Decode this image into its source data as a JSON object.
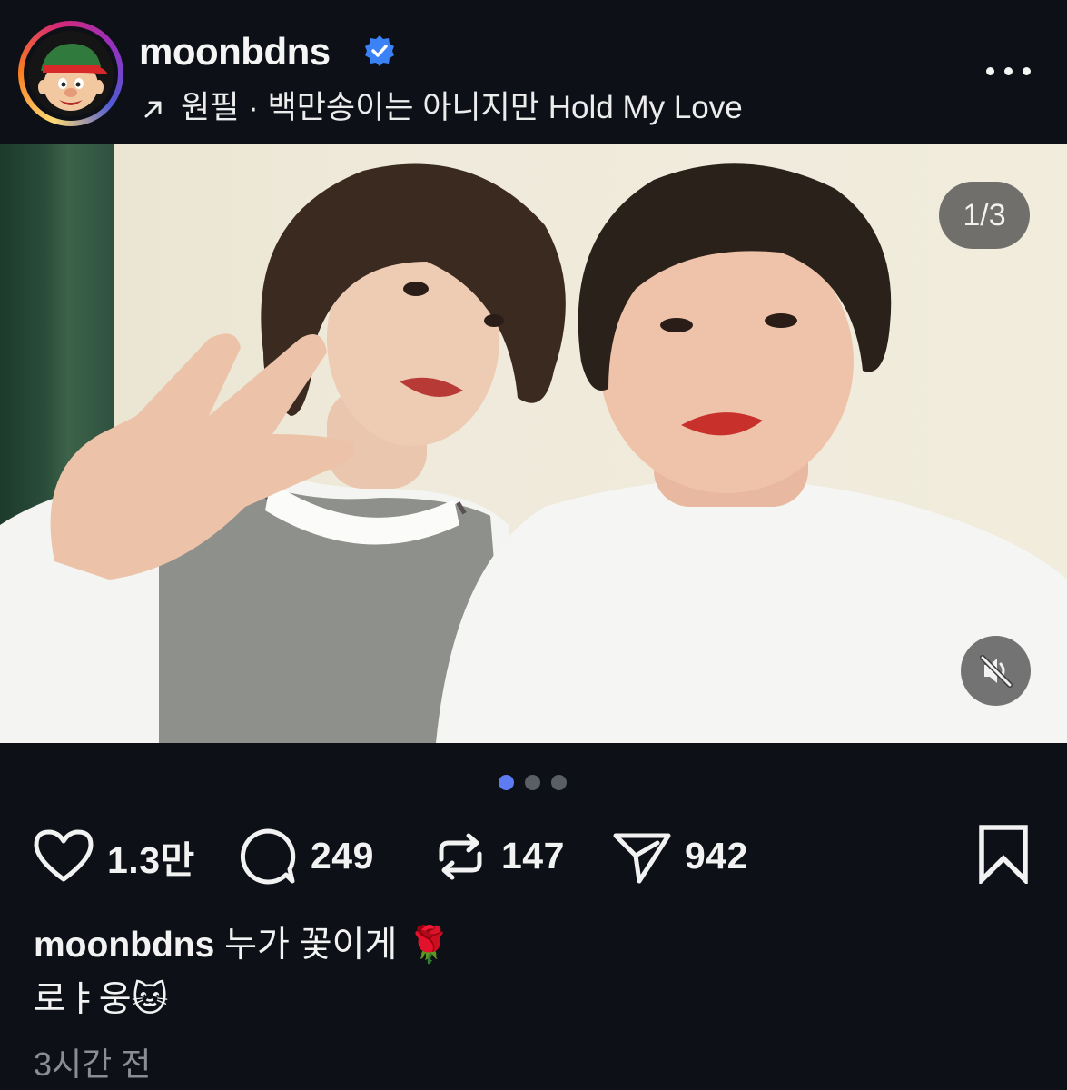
{
  "post": {
    "username": "moonbdns",
    "verified": true,
    "music_label": "원필 · 백만송이는 아니지만 Hold My Love",
    "image_counter": "1/3",
    "carousel": {
      "count": 3,
      "active_index": 0
    }
  },
  "actions": {
    "likes": "1.3만",
    "comments": "249",
    "reposts": "147",
    "shares": "942"
  },
  "caption": {
    "username": "moonbdns",
    "text": "누가 꽃이게 🌹",
    "line2": "로ㅑ웅🐱"
  },
  "time_ago": "3시간 전",
  "icons": {
    "verified": "verified-badge-icon",
    "music": "arrow-up-right-icon",
    "more": "more-horizontal-icon",
    "mute": "speaker-muted-icon",
    "like": "heart-icon",
    "comment": "comment-bubble-icon",
    "repost": "repost-icon",
    "share": "paper-plane-icon",
    "save": "bookmark-icon"
  },
  "colors": {
    "background": "#0d1117",
    "accent_dot": "#5d7cf2",
    "verified_blue": "#3b82f6"
  }
}
